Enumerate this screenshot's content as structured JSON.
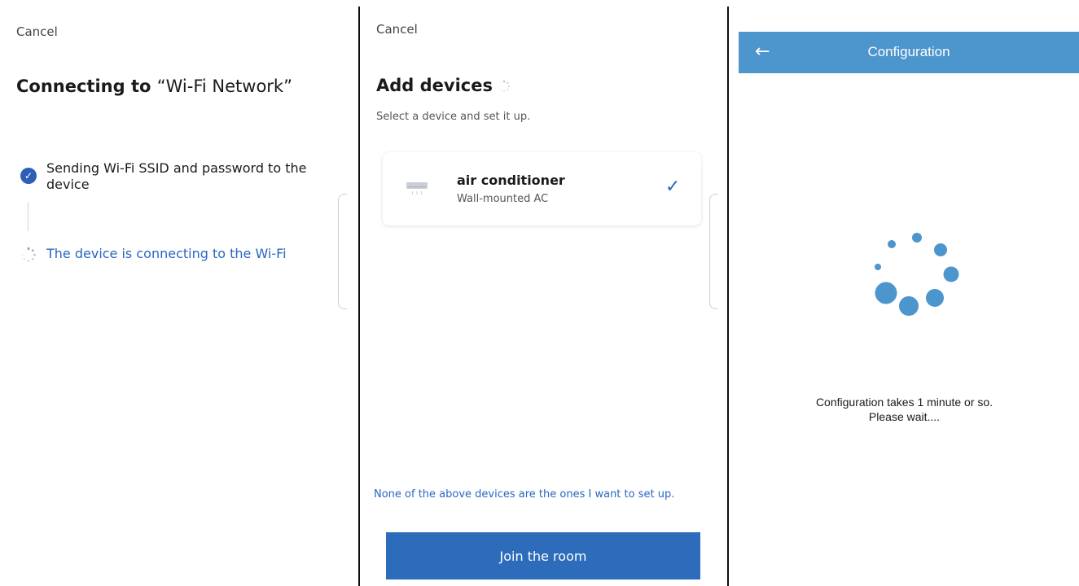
{
  "panel1": {
    "cancel_label": "Cancel",
    "title_prefix": "Connecting to ",
    "title_network": "“Wi-Fi Network”",
    "step1_label": "Sending Wi-Fi SSID and password to the device",
    "step2_label": "The device is connecting to the Wi-Fi",
    "icons": {
      "step1": "check-circle-icon",
      "step2": "loading-spinner-icon"
    }
  },
  "panel2": {
    "cancel_label": "Cancel",
    "title": "Add devices",
    "subtitle": "Select a device and set it up.",
    "device": {
      "name": "air conditioner",
      "subtitle": "Wall-mounted AC",
      "icon": "air-conditioner-icon",
      "selected": true
    },
    "none_link": "None of the above devices are the ones I want to set up.",
    "join_button": "Join the room"
  },
  "panel3": {
    "header_title": "Configuration",
    "back_icon": "back-arrow-icon",
    "message_line1": "Configuration takes 1 minute or so.",
    "message_line2": "Please wait...."
  },
  "colors": {
    "link_blue": "#2a66c2",
    "button_blue": "#2c6cba",
    "header_blue": "#4d95cd",
    "loader_blue": "#4d95cd",
    "divider": "#111111"
  }
}
